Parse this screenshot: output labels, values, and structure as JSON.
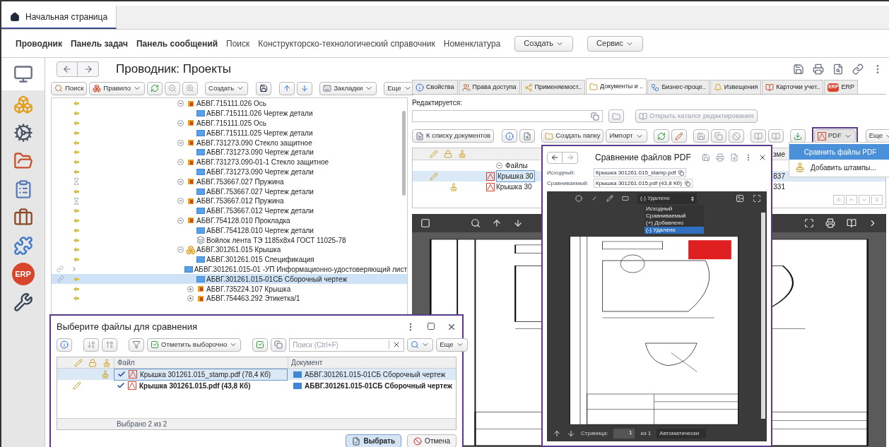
{
  "home_tab": {
    "label": "Начальная страница",
    "selected": true
  },
  "nav": [
    {
      "label": "Проводник",
      "kind": "section"
    },
    {
      "label": "Панель задач",
      "kind": "section"
    },
    {
      "label": "Панель сообщений",
      "kind": "section"
    },
    {
      "label": "Поиск",
      "kind": "link"
    },
    {
      "label": "Конструкторско-технологический справочник",
      "kind": "link"
    },
    {
      "label": "Номенклатура",
      "kind": "link"
    }
  ],
  "nav_buttons": [
    {
      "label": "Создать"
    },
    {
      "label": "Сервис"
    }
  ],
  "sidebar": [
    {
      "kind": "monitor",
      "selected": true
    },
    {
      "kind": "cubes",
      "selected": false
    },
    {
      "kind": "gears",
      "selected": false
    },
    {
      "kind": "binders",
      "selected": false
    },
    {
      "kind": "clipboard",
      "selected": false
    },
    {
      "kind": "briefcase",
      "selected": false
    },
    {
      "kind": "puzzle",
      "selected": false
    },
    {
      "kind": "erp",
      "label": "ERP",
      "selected": false
    },
    {
      "kind": "tools",
      "selected": false
    }
  ],
  "page": {
    "title": "Проводник: Проекты"
  },
  "left_toolbar": [
    {
      "kind": "search",
      "label": "Поиск",
      "dropdown": false
    },
    {
      "kind": "rule",
      "label": "Правило",
      "dropdown": true
    },
    {
      "kind": "refresh"
    },
    {
      "kind": "collapse"
    },
    {
      "kind": "expand"
    },
    {
      "kind": "plain",
      "label": "Создать",
      "dropdown": true
    },
    {
      "kind": "save"
    },
    {
      "kind": "up"
    },
    {
      "kind": "down"
    },
    {
      "kind": "bookmarks",
      "label": "Закладки",
      "dropdown": true
    },
    {
      "kind": "plain",
      "label": "Еще",
      "dropdown": true
    }
  ],
  "tree": [
    {
      "label": "АБВГ.715111.026 Ось",
      "kind": "part",
      "marker": {
        "kind": "arrow"
      },
      "attached": false,
      "expanded": true,
      "selected": false,
      "children": [
        {
          "label": "АБВГ.715111.026 Чертеж детали",
          "kind": "document",
          "marker": {
            "kind": "arrow"
          },
          "attached": false,
          "selected": false
        }
      ]
    },
    {
      "label": "АБВГ.715111.025 Ось",
      "kind": "part",
      "marker": {
        "kind": "arrow"
      },
      "attached": false,
      "expanded": true,
      "selected": false,
      "children": [
        {
          "label": "АБВГ.715111.025 Чертеж детали",
          "kind": "document",
          "marker": {
            "kind": "arrow"
          },
          "attached": false,
          "selected": false
        }
      ]
    },
    {
      "label": "АБВГ.731273.090 Стекло защитное",
      "kind": "part",
      "marker": {
        "kind": "arrow"
      },
      "attached": false,
      "expanded": true,
      "selected": false,
      "children": [
        {
          "label": "АБВГ.731273.090 Чертеж детали",
          "kind": "document",
          "marker": {
            "kind": "arrow"
          },
          "attached": false,
          "selected": false
        }
      ]
    },
    {
      "label": "АБВГ.731273.090-01-1 Стекло защитное",
      "kind": "part",
      "marker": {
        "kind": "arrow"
      },
      "attached": false,
      "expanded": true,
      "selected": false,
      "children": [
        {
          "label": "АБВГ.731273.090 Чертеж детали",
          "kind": "document",
          "marker": {
            "kind": "arrow"
          },
          "attached": false,
          "selected": false
        }
      ]
    },
    {
      "label": "АБВГ.753667.027 Пружина",
      "kind": "part",
      "marker": {
        "kind": "waiting"
      },
      "attached": false,
      "expanded": true,
      "selected": false,
      "children": [
        {
          "label": "АБВГ.753667.027 Чертеж детали",
          "kind": "document",
          "marker": {
            "kind": "arrow"
          },
          "attached": false,
          "selected": false
        }
      ]
    },
    {
      "label": "АБВГ.753667.012 Пружина",
      "kind": "part",
      "marker": {
        "kind": "waiting"
      },
      "attached": false,
      "expanded": true,
      "selected": false,
      "children": [
        {
          "label": "АБВГ.753667.012 Чертеж детали",
          "kind": "document",
          "marker": {
            "kind": "arrow"
          },
          "attached": false,
          "selected": false
        }
      ]
    },
    {
      "label": "АБВГ.754128.010 Прокладка",
      "kind": "part",
      "marker": {
        "kind": "arrow"
      },
      "attached": false,
      "expanded": true,
      "selected": false,
      "children": [
        {
          "label": "АБВГ.754128.010 Чертеж детали",
          "kind": "document",
          "marker": {
            "kind": "arrow"
          },
          "attached": false,
          "selected": false
        },
        {
          "label": "Войлок лента ТЭ 1185x8x4 ГОСТ 11025-78",
          "kind": "material",
          "marker": {
            "kind": "arrow"
          },
          "attached": false,
          "selected": false
        }
      ]
    },
    {
      "label": "АБВГ.301261.015 Крышка",
      "kind": "assembly",
      "marker": {
        "kind": "arrow"
      },
      "attached": false,
      "expanded": true,
      "selected": false,
      "children": [
        {
          "label": "АБВГ.301261.015 Спецификация",
          "kind": "document",
          "marker": {
            "kind": "arrow"
          },
          "attached": false,
          "selected": false
        },
        {
          "label": "АБВГ.301261.015-01 -УП Информационно-удостоверяющий лист",
          "kind": "document",
          "marker": {
            "kind": "pointer"
          },
          "attached": true,
          "selected": false
        },
        {
          "label": "АБВГ.301261.015-01СБ Сборочный чертеж",
          "kind": "document",
          "marker": {
            "kind": "arrow"
          },
          "attached": true,
          "selected": true
        },
        {
          "label": "АБВГ.735224.107 Крышка",
          "kind": "part",
          "marker": {
            "kind": "arrow"
          },
          "attached": false,
          "expanded": false,
          "selected": false
        },
        {
          "label": "АБВГ.754463.292 Этикетка/1",
          "kind": "part",
          "marker": {
            "kind": "arrow"
          },
          "attached": false,
          "expanded": false,
          "selected": false
        }
      ]
    }
  ],
  "tabs": [
    {
      "label": "Свойства",
      "kind": "info",
      "selected": false
    },
    {
      "label": "Права доступа",
      "kind": "users",
      "selected": false
    },
    {
      "label": "Применяемост..",
      "kind": "usage",
      "selected": false
    },
    {
      "label": "Документы и ..",
      "kind": "docs",
      "selected": true
    },
    {
      "label": "Бизнес-проце..",
      "kind": "process",
      "selected": false
    },
    {
      "label": "Извещения",
      "kind": "notice",
      "selected": false
    },
    {
      "label": "Карточки учет..",
      "kind": "cards",
      "selected": false
    },
    {
      "label": "ERP",
      "kind": "erp",
      "badge": "ERP",
      "selected": false
    }
  ],
  "editing": {
    "label": "Редактируется:",
    "open_catalog": "Открыть каталог редактирования",
    "disabled": true
  },
  "doc_toolbar": [
    {
      "kind": "list",
      "label": "К списку документов"
    },
    {
      "kind": "info"
    },
    {
      "kind": "preview"
    },
    {
      "kind": "folder",
      "label": "Создать папку"
    },
    {
      "kind": "menu",
      "label": "Импорт"
    },
    {
      "kind": "refresh"
    },
    {
      "kind": "pencil"
    },
    {
      "kind": "save"
    },
    {
      "kind": "copy"
    },
    {
      "kind": "cancel"
    },
    {
      "kind": "book"
    },
    {
      "kind": "book"
    },
    {
      "kind": "download"
    },
    {
      "kind": "pdf",
      "label": "PDF"
    },
    {
      "kind": "menu",
      "label": "Еще"
    }
  ],
  "files": {
    "group": "Файлы",
    "expanded": true,
    "column_2": "зме",
    "rows": [
      {
        "name": "Крышка 30",
        "column_2": "837",
        "editing": true,
        "stamped": false,
        "selected": true
      },
      {
        "name": "Крышка 30",
        "column_2": "331",
        "editing": false,
        "stamped": true,
        "selected": false
      }
    ]
  },
  "pdf_menu": [
    {
      "label": "Сравнить файлы PDF",
      "kind": "compare",
      "selected": true
    },
    {
      "label": "Добавить штампы...",
      "kind": "stamp",
      "selected": false
    }
  ],
  "compare": {
    "title": "Сравнение файлов PDF",
    "source_label": "Исходный:",
    "source": "Крышка 301261.015_stamp.pdf",
    "target_label": "Сравниваемый:",
    "target": "Крышка 301261.015.pdf (43,8 Кб)",
    "mode": "(-) Удалено",
    "mode_options": [
      {
        "label": "Исходный",
        "selected": false
      },
      {
        "label": "Сравниваемый",
        "selected": false
      },
      {
        "label": "(+) Добавлено",
        "selected": false
      },
      {
        "label": "(-) Удалено",
        "selected": true
      }
    ],
    "page_label": "Страница:",
    "page": "1",
    "page_total": "из 1",
    "zoom": "Автоматически"
  },
  "select_dialog": {
    "title": "Выберите файлы для сравнения",
    "mark_button": "Отметить выборочно",
    "search_placeholder": "Поиск (Ctrl+F)",
    "more": "Еще",
    "columns": [
      "Файл",
      "Документ"
    ],
    "rows": [
      {
        "file": "Крышка 301261.015_stamp.pdf (78,4 Кб)",
        "document": "АБВГ.301261.015-01СБ Сборочный чертеж",
        "checked": true,
        "editing": false,
        "stamped": true,
        "emphasized": false,
        "selected": true
      },
      {
        "file": "Крышка 301261.015.pdf (43,8 Кб)",
        "document": "АБВГ.301261.015-01СБ Сборочный чертеж",
        "checked": true,
        "editing": true,
        "stamped": false,
        "emphasized": true,
        "selected": false
      }
    ],
    "footer": "Выбрано 2 из 2",
    "ok": "Выбрать",
    "cancel": "Отмена"
  }
}
